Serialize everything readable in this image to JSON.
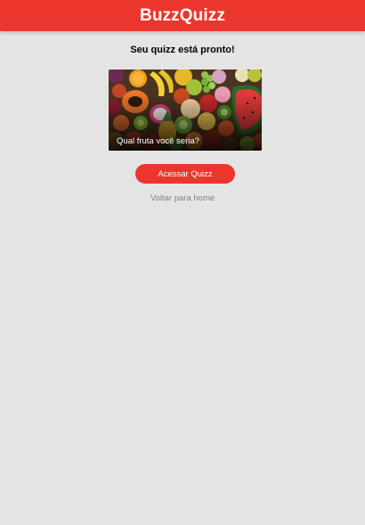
{
  "header": {
    "brand": "BuzzQuizz",
    "background_color": "#ec362d"
  },
  "success": {
    "title": "Seu quizz está pronto!"
  },
  "quiz_card": {
    "title": "Qual fruta você seria?",
    "image": "fruits-photo"
  },
  "actions": {
    "access_label": "Acessar Quizz",
    "home_label": "Voltar para home",
    "accent_color": "#ec362d"
  },
  "colors": {
    "page_background": "#e4e4e4",
    "link_gray": "#818181"
  }
}
